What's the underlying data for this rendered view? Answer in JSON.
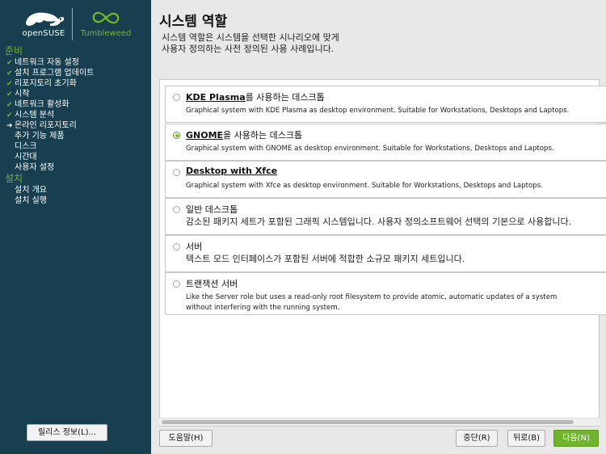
{
  "sidebar": {
    "logo_left_text": "openSUSE",
    "logo_right_text": "Tumbleweed",
    "sections": [
      {
        "title": "준비",
        "steps": [
          {
            "label": "네트워크 자동 설정",
            "state": "done"
          },
          {
            "label": "설치 프로그램 업데이트",
            "state": "done"
          },
          {
            "label": "리포지토리 초기화",
            "state": "done"
          },
          {
            "label": "시작",
            "state": "done"
          },
          {
            "label": "네트워크 활성화",
            "state": "done"
          },
          {
            "label": "시스템 분석",
            "state": "done"
          },
          {
            "label": "온라인 리포지토리",
            "state": "current"
          },
          {
            "label": "추가 기능 제품",
            "state": "pending"
          },
          {
            "label": "디스크",
            "state": "pending"
          },
          {
            "label": "시간대",
            "state": "pending"
          },
          {
            "label": "사용자 설정",
            "state": "pending"
          }
        ]
      },
      {
        "title": "설치",
        "steps": [
          {
            "label": "설치 개요",
            "state": "pending"
          },
          {
            "label": "설치 실행",
            "state": "pending"
          }
        ]
      }
    ],
    "release_notes_label": "릴리스 정보(L)..."
  },
  "main": {
    "title": "시스템 역할",
    "description_line1": "시스템 역할은 시스템을 선택한 시나리오에 맞게",
    "description_line2": "사용자 정의하는 사전 정의된 사용 사례입니다.",
    "roles": [
      {
        "title_bold": "KDE Plasma",
        "title_rest": "를 사용하는 데스크톱",
        "selected": false,
        "desc": [
          "Graphical system with KDE Plasma as desktop environment. Suitable for Workstations, Desktops and Laptops."
        ],
        "desc_big": false
      },
      {
        "title_bold": "GNOME",
        "title_rest": "을 사용하는 데스크톱",
        "selected": true,
        "desc": [
          "Graphical system with GNOME as desktop environment. Suitable for Workstations, Desktops and Laptops."
        ],
        "desc_big": false
      },
      {
        "title_bold": "Desktop with Xfce",
        "title_rest": "",
        "selected": false,
        "desc": [
          "Graphical system with Xfce as desktop environment. Suitable for Workstations, Desktops and Laptops."
        ],
        "desc_big": false
      },
      {
        "title_bold": "",
        "title_rest": "일반 데스크톱",
        "selected": false,
        "desc": [
          "감소된 패키지 세트가 포함된 그래픽 시스템입니다. 사용자 정의소프트웨어 선택의 기본으로 사용합니다."
        ],
        "desc_big": true
      },
      {
        "title_bold": "",
        "title_rest": "서버",
        "selected": false,
        "desc": [
          "텍스트 모드 인터페이스가 포함된 서버에 적합한 소규모 패키지 세트입니다."
        ],
        "desc_big": true
      },
      {
        "title_bold": "",
        "title_rest": "트랜잭션 서버",
        "selected": false,
        "desc": [
          "Like the Server role but uses a read-only root filesystem to provide atomic, automatic updates of a system",
          "without interfering with the running system."
        ],
        "desc_big": false
      }
    ]
  },
  "buttons": {
    "help": "도움말(H)",
    "abort": "중단(R)",
    "back": "뒤로(B)",
    "next": "다음(N)"
  },
  "colors": {
    "sidebar_bg": "#173f4f",
    "accent_green": "#73ba25",
    "main_bg": "#e8e8e8"
  }
}
